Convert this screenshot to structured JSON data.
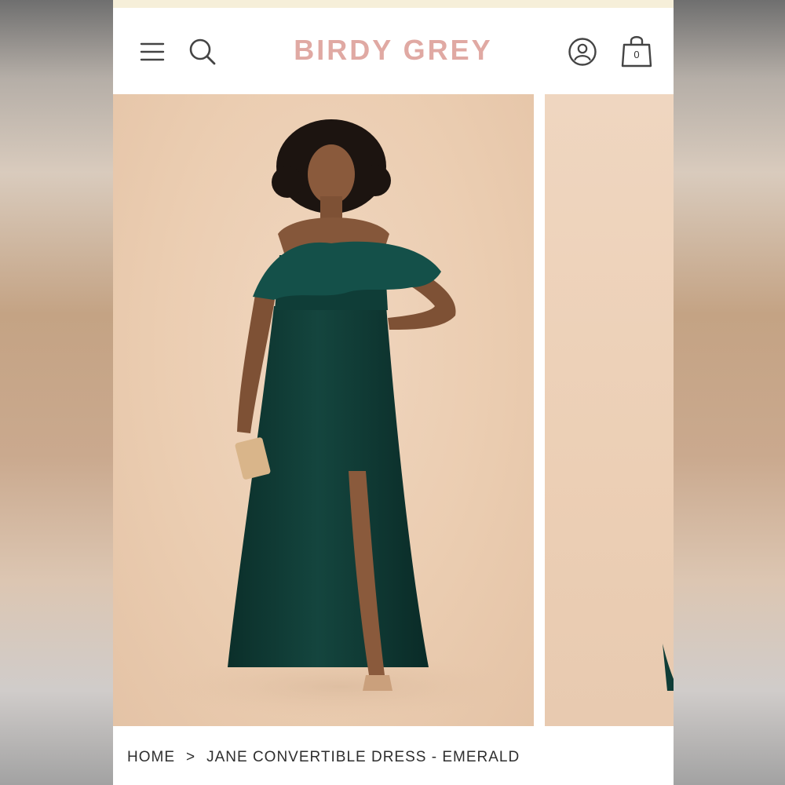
{
  "header": {
    "logo": "BIRDY GREY",
    "bag_count": "0"
  },
  "icons": {
    "menu": "hamburger-menu-icon",
    "search": "search-icon",
    "account": "user-account-icon",
    "bag": "shopping-bag-icon"
  },
  "breadcrumb": {
    "home": "HOME",
    "separator": ">",
    "current": "JANE CONVERTIBLE DRESS - EMERALD"
  },
  "colors": {
    "logo": "#e0a9a3",
    "dress": "#0f3d37",
    "backdrop": "#ebcdb1"
  }
}
